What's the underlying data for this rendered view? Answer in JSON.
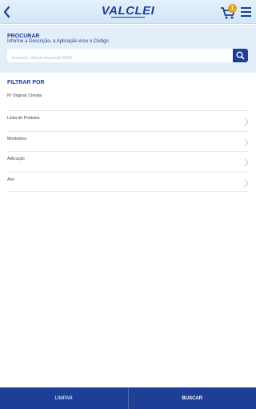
{
  "header": {
    "logo_text": "VALCLEI",
    "cart_count": "1"
  },
  "search": {
    "title": "PROCURAR",
    "subtitle": "Informe a Descrição, a Aplicação e/ou o Código",
    "placeholder": "Exemplo: Válvula expansão BMW",
    "value": ""
  },
  "filter": {
    "title": "FILTRAR POR",
    "subtitle": "Nº Original | Similar",
    "items": [
      {
        "label": "Linha de Produtos"
      },
      {
        "label": "Montadora"
      },
      {
        "label": "Aplicação"
      },
      {
        "label": "Ano"
      }
    ]
  },
  "bottom": {
    "clear_label": "LIMPAR",
    "search_label": "BUSCAR"
  },
  "colors": {
    "brand": "#1d3f95",
    "badge": "#e0a21c",
    "header_bg": "#d2e6f6",
    "search_bg": "#e4eef8"
  },
  "icons": [
    "back-arrow-icon",
    "cart-icon",
    "hamburger-menu-icon",
    "search-icon",
    "chevron-right-icon"
  ]
}
